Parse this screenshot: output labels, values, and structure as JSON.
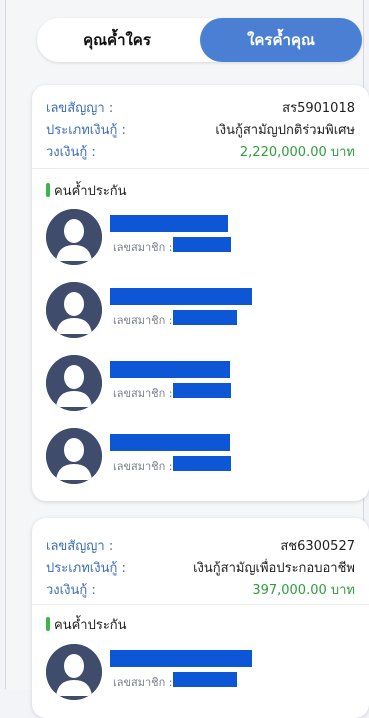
{
  "tabs": {
    "left": "คุณค้ำใคร",
    "right": "ใครค้ำคุณ",
    "active": "right"
  },
  "labels": {
    "contract": "เลขสัญญา :",
    "loan_type": "ประเภทเงินกู้ :",
    "credit": "วงเงินกู้ :",
    "guarantors": "คนค้ำประกัน",
    "member_no": "เลขสมาชิก :"
  },
  "colors": {
    "accent": "#4a7fd4",
    "label": "#3d6fb6",
    "amount": "#2e9e3c",
    "redaction": "#0d57d6",
    "guarantor_marker": "#3cb54a"
  },
  "contracts": [
    {
      "contract_no": "สร5901018",
      "loan_type": "เงินกู้สามัญปกติร่วมพิเศษ",
      "amount": "2,220,000.00 บาท"
    },
    {
      "contract_no": "สช6300527",
      "loan_type": "เงินกู้สามัญเพื่อประกอบอาชีพ",
      "amount": "397,000.00 บาท"
    }
  ]
}
